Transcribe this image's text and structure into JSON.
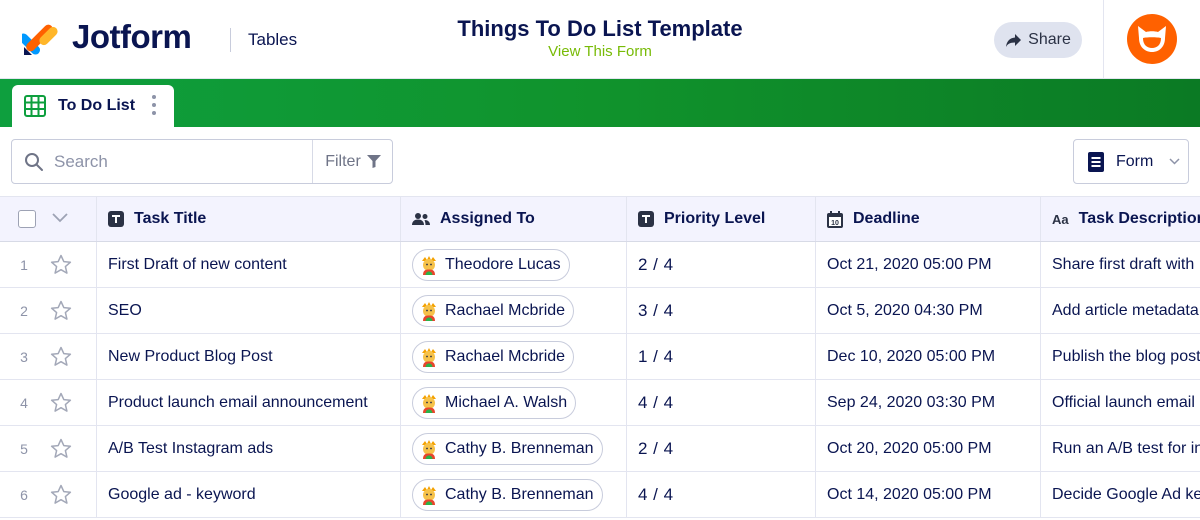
{
  "header": {
    "brand": "Jotform",
    "product": "Tables",
    "form_title": "Things To Do List Template",
    "form_link": "View This Form",
    "share_label": "Share",
    "avatar_icon": "cat-avatar-icon"
  },
  "tabs": [
    {
      "label": "To Do List",
      "icon": "table-grid-icon"
    }
  ],
  "toolbar": {
    "search_placeholder": "Search",
    "filter_label": "Filter",
    "form_label": "Form"
  },
  "table": {
    "columns": [
      {
        "label": "Task Title",
        "icon": "text-type-icon"
      },
      {
        "label": "Assigned To",
        "icon": "users-icon"
      },
      {
        "label": "Priority Level",
        "icon": "text-type-icon"
      },
      {
        "label": "Deadline",
        "icon": "calendar-icon"
      },
      {
        "label": "Task Description",
        "icon": "font-aa-icon"
      }
    ],
    "rows": [
      {
        "num": "1",
        "title": "First Draft of new content",
        "assigned": "Theodore Lucas",
        "priority": "2 / 4",
        "deadline": "Oct 21, 2020 05:00 PM",
        "description": "Share first draft with"
      },
      {
        "num": "2",
        "title": "SEO",
        "assigned": "Rachael Mcbride",
        "priority": "3 / 4",
        "deadline": "Oct 5, 2020 04:30 PM",
        "description": "Add article metadata"
      },
      {
        "num": "3",
        "title": "New Product Blog Post",
        "assigned": "Rachael Mcbride",
        "priority": "1 / 4",
        "deadline": "Dec 10, 2020 05:00 PM",
        "description": "Publish the blog post"
      },
      {
        "num": "4",
        "title": "Product launch email announcement",
        "assigned": "Michael A. Walsh",
        "priority": "4 / 4",
        "deadline": "Sep 24, 2020 03:30 PM",
        "description": "Official launch email"
      },
      {
        "num": "5",
        "title": "A/B Test Instagram ads",
        "assigned": "Cathy B. Brenneman",
        "priority": "2 / 4",
        "deadline": "Oct 20, 2020 05:00 PM",
        "description": "Run an A/B test for in"
      },
      {
        "num": "6",
        "title": "Google ad - keyword",
        "assigned": "Cathy B. Brenneman",
        "priority": "4 / 4",
        "deadline": "Oct 14, 2020 05:00 PM",
        "description": "Decide Google Ad key"
      }
    ]
  },
  "colors": {
    "brand_navy": "#0a1551",
    "tab_green": "#10932c",
    "link_green": "#78bb07",
    "avatar_orange": "#ff6100",
    "header_bg": "#f3f3fe"
  }
}
